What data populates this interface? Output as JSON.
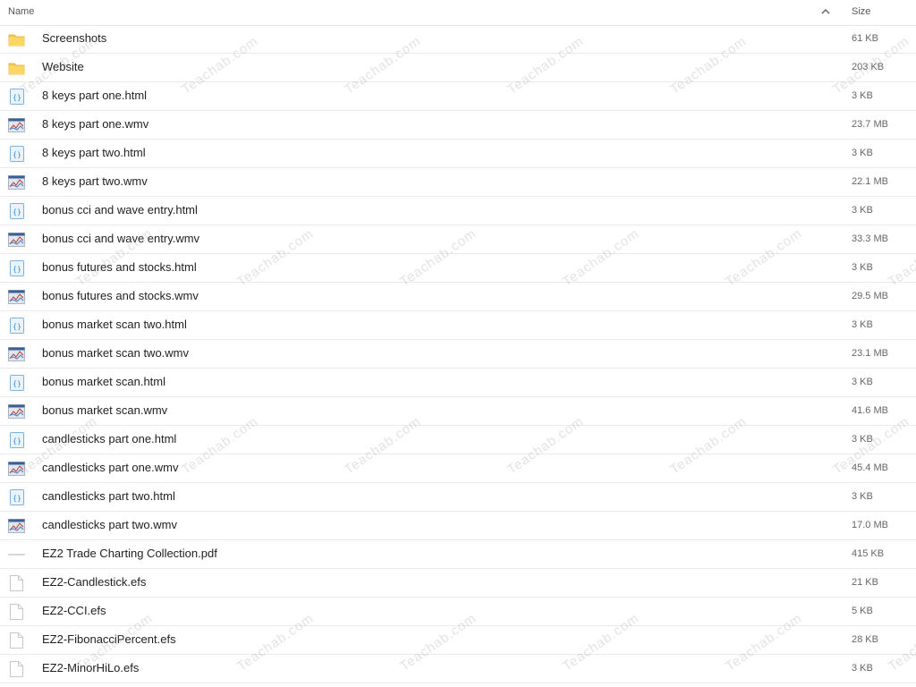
{
  "header": {
    "name_label": "Name",
    "size_label": "Size",
    "sort_icon": "chevron-up-icon"
  },
  "files": [
    {
      "name": "Screenshots",
      "size": "61 KB",
      "icon": "folder-icon"
    },
    {
      "name": "Website",
      "size": "203 KB",
      "icon": "folder-icon"
    },
    {
      "name": "8 keys part one.html",
      "size": "3 KB",
      "icon": "html-file-icon"
    },
    {
      "name": "8 keys part one.wmv",
      "size": "23.7 MB",
      "icon": "video-thumbnail-icon"
    },
    {
      "name": "8 keys part two.html",
      "size": "3 KB",
      "icon": "html-file-icon"
    },
    {
      "name": "8 keys part two.wmv",
      "size": "22.1 MB",
      "icon": "video-thumbnail-icon"
    },
    {
      "name": "bonus cci and wave entry.html",
      "size": "3 KB",
      "icon": "html-file-icon"
    },
    {
      "name": "bonus cci and wave entry.wmv",
      "size": "33.3 MB",
      "icon": "video-thumbnail-icon"
    },
    {
      "name": "bonus futures and stocks.html",
      "size": "3 KB",
      "icon": "html-file-icon"
    },
    {
      "name": "bonus futures and stocks.wmv",
      "size": "29.5 MB",
      "icon": "video-thumbnail-icon"
    },
    {
      "name": "bonus market scan two.html",
      "size": "3 KB",
      "icon": "html-file-icon"
    },
    {
      "name": "bonus market scan two.wmv",
      "size": "23.1 MB",
      "icon": "video-thumbnail-icon"
    },
    {
      "name": "bonus market scan.html",
      "size": "3 KB",
      "icon": "html-file-icon"
    },
    {
      "name": "bonus market scan.wmv",
      "size": "41.6 MB",
      "icon": "video-thumbnail-icon"
    },
    {
      "name": "candlesticks part one.html",
      "size": "3 KB",
      "icon": "html-file-icon"
    },
    {
      "name": "candlesticks part one.wmv",
      "size": "45.4 MB",
      "icon": "video-thumbnail-icon"
    },
    {
      "name": "candlesticks part two.html",
      "size": "3 KB",
      "icon": "html-file-icon"
    },
    {
      "name": "candlesticks part two.wmv",
      "size": "17.0 MB",
      "icon": "video-thumbnail-icon"
    },
    {
      "name": "EZ2 Trade Charting Collection.pdf",
      "size": "415 KB",
      "icon": "pdf-thumbnail-icon"
    },
    {
      "name": "EZ2-Candlestick.efs",
      "size": "21 KB",
      "icon": "generic-file-icon"
    },
    {
      "name": "EZ2-CCI.efs",
      "size": "5 KB",
      "icon": "generic-file-icon"
    },
    {
      "name": "EZ2-FibonacciPercent.efs",
      "size": "28 KB",
      "icon": "generic-file-icon"
    },
    {
      "name": "EZ2-MinorHiLo.efs",
      "size": "3 KB",
      "icon": "generic-file-icon"
    }
  ],
  "watermark": {
    "text": "Teachab.com"
  },
  "colors": {
    "folder": "#f5c84a",
    "html_icon": "#4a9ad6",
    "divider": "#e9e9e9"
  }
}
